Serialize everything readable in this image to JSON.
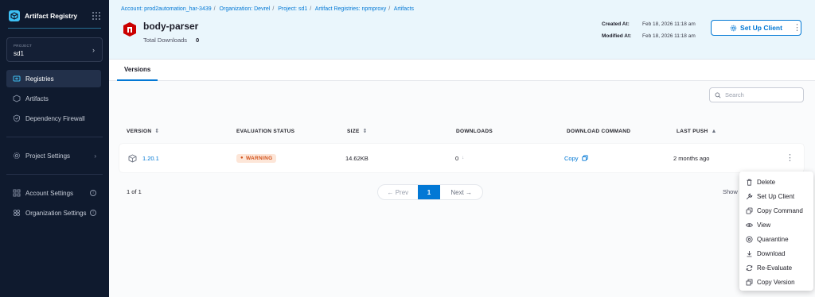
{
  "sidebar": {
    "app_title": "Artifact Registry",
    "project_label": "PROJECT",
    "project_name": "sd1",
    "nav": [
      {
        "label": "Registries",
        "icon": "registries-icon",
        "active": true
      },
      {
        "label": "Artifacts",
        "icon": "artifacts-icon"
      },
      {
        "label": "Dependency Firewall",
        "icon": "shield-icon"
      }
    ],
    "project_settings": "Project Settings",
    "account_settings": "Account Settings",
    "organization_settings": "Organization Settings"
  },
  "header": {
    "breadcrumb": [
      "Account: prod2automation_har-3439",
      "Organization: Devrel",
      "Project: sd1",
      "Artifact Registries: npmproxy",
      "Artifacts"
    ],
    "package_name": "body-parser",
    "total_downloads_label": "Total Downloads",
    "total_downloads_value": "0",
    "created_label": "Created At:",
    "created_value": "Feb 18, 2026 11:18 am",
    "modified_label": "Modified At:",
    "modified_value": "Feb 18, 2026 11:18 am",
    "setup_client_label": "Set Up Client",
    "accent_color": "#0278d5",
    "npm_color": "#cb0000"
  },
  "tabs": [
    {
      "label": "Versions",
      "active": true
    }
  ],
  "search": {
    "placeholder": "Search",
    "value": ""
  },
  "table": {
    "columns": [
      "VERSION",
      "EVALUATION STATUS",
      "SIZE",
      "DOWNLOADS",
      "DOWNLOAD COMMAND",
      "LAST PUSH"
    ],
    "rows": [
      {
        "version": "1.20.1",
        "status": "WARNING",
        "size": "14.62KB",
        "downloads": "0",
        "download_command": "Copy",
        "last_push": "2 months ago"
      }
    ]
  },
  "pagination": {
    "info": "1 of 1",
    "prev": "← Prev",
    "current": "1",
    "next": "Next →",
    "show_label": "Show"
  },
  "menu": {
    "items": [
      {
        "label": "Delete",
        "icon": "trash-icon"
      },
      {
        "label": "Set Up Client",
        "icon": "tool-icon"
      },
      {
        "label": "Copy Command",
        "icon": "copy-icon"
      },
      {
        "label": "View",
        "icon": "eye-icon"
      },
      {
        "label": "Quarantine",
        "icon": "quarantine-icon"
      },
      {
        "label": "Download",
        "icon": "download-icon"
      },
      {
        "label": "Re-Evaluate",
        "icon": "refresh-icon"
      },
      {
        "label": "Copy Version",
        "icon": "copy-version-icon"
      }
    ]
  }
}
